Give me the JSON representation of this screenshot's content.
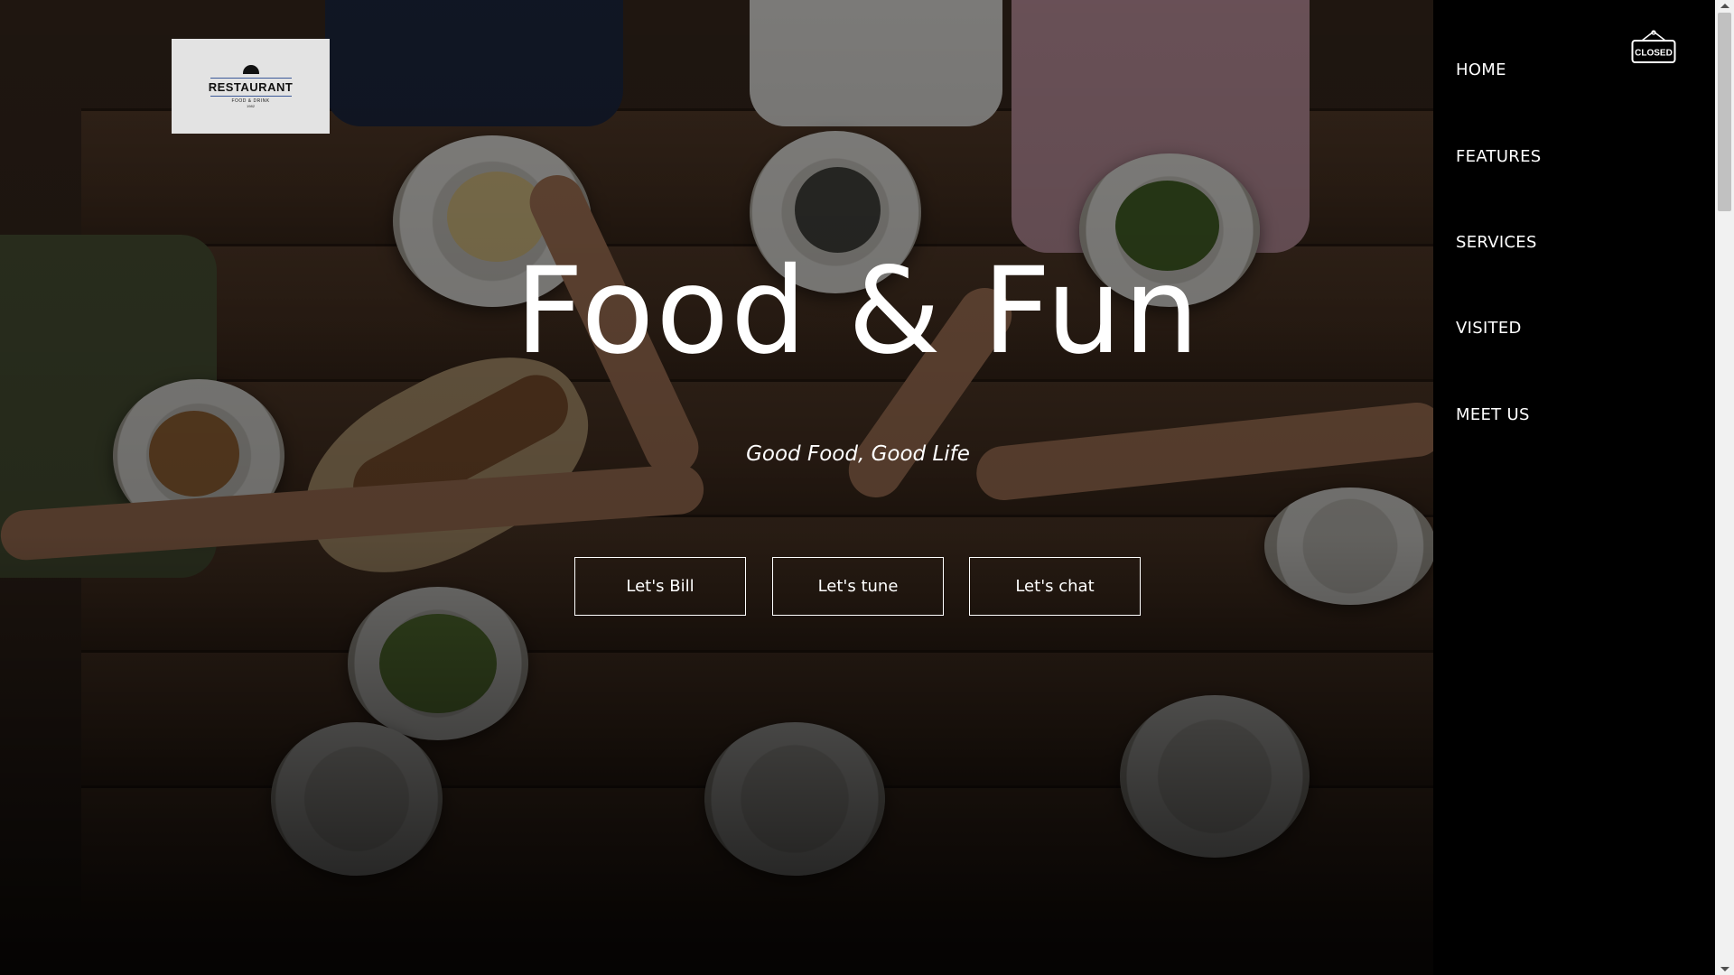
{
  "logo": {
    "name": "RESTAURANT",
    "tagline": "FOOD & DRINK",
    "year": "1982"
  },
  "hero": {
    "title": "Food & Fun",
    "subtitle": "Good Food, Good Life"
  },
  "buttons": [
    {
      "label": "Let's Bill"
    },
    {
      "label": "Let's tune"
    },
    {
      "label": "Let's chat"
    }
  ],
  "nav": {
    "items": [
      {
        "label": "HOME"
      },
      {
        "label": "FEATURES"
      },
      {
        "label": "SERVICES"
      },
      {
        "label": "VISITED"
      },
      {
        "label": "MEET US"
      }
    ],
    "status_sign": "CLOSED"
  },
  "colors": {
    "nav_background": "#000000",
    "text": "#ffffff",
    "logo_background": "#e3e3e3"
  }
}
